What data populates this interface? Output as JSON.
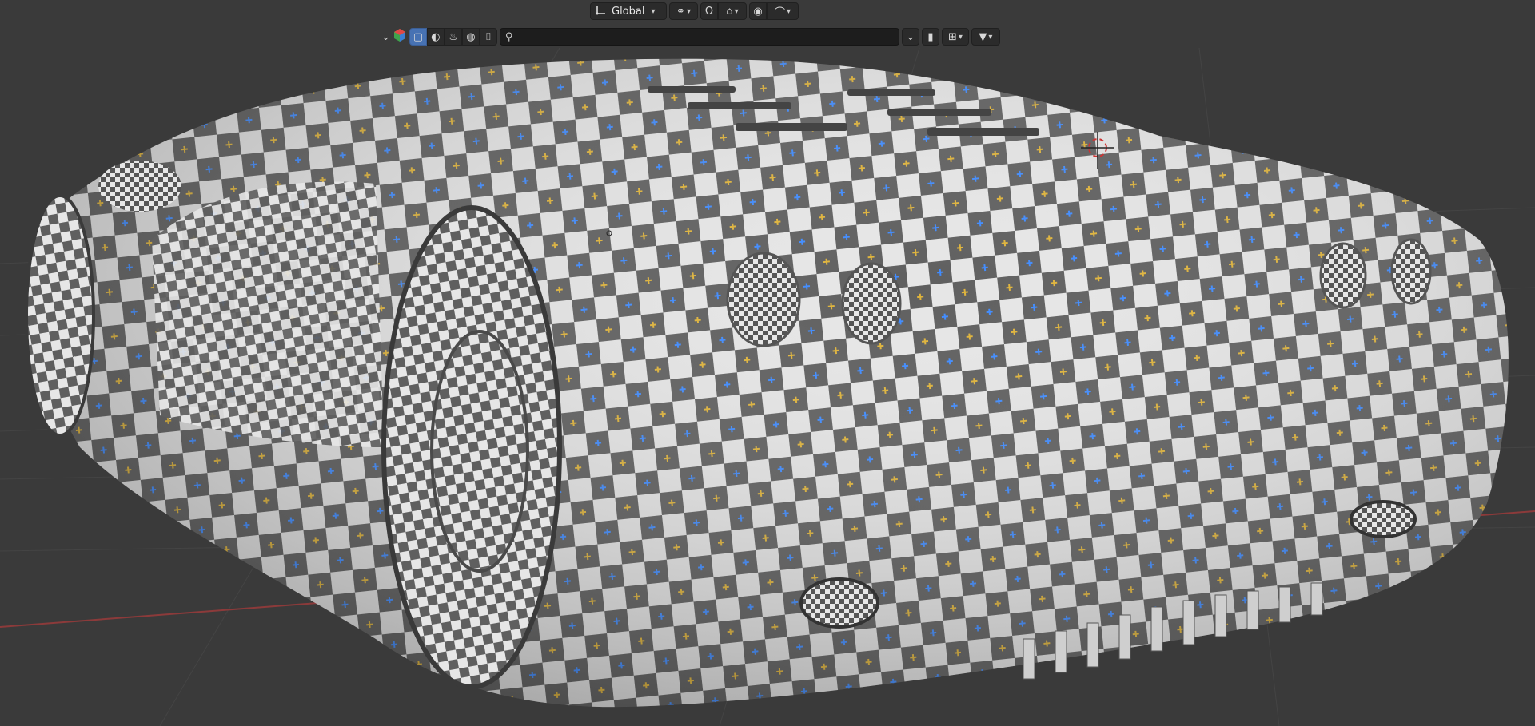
{
  "header_top": {
    "orientation_label": "Global",
    "icons": [
      "transform-orientation-icon",
      "pivot-point-icon",
      "snap-icon",
      "proportional-editing-icon"
    ]
  },
  "header_second": {
    "search": {
      "value": "",
      "placeholder": ""
    },
    "icons": [
      "chevron-down-icon",
      "scene-color-icon",
      "solid-shading-icon",
      "material-preview-icon",
      "render-preview-icon",
      "overlay-icon",
      "brush-icon",
      "search-icon",
      "bookmark-icon",
      "hierarchy-icon",
      "filter-icon"
    ]
  },
  "colors": {
    "viewport_bg": "#3a3a3a",
    "header_bg": "#2b2b2b",
    "active_button": "#4772b3",
    "axis_x": "#8c3a3a",
    "checker_light": "#e8e8e8",
    "checker_dark": "#5e5e5e"
  }
}
